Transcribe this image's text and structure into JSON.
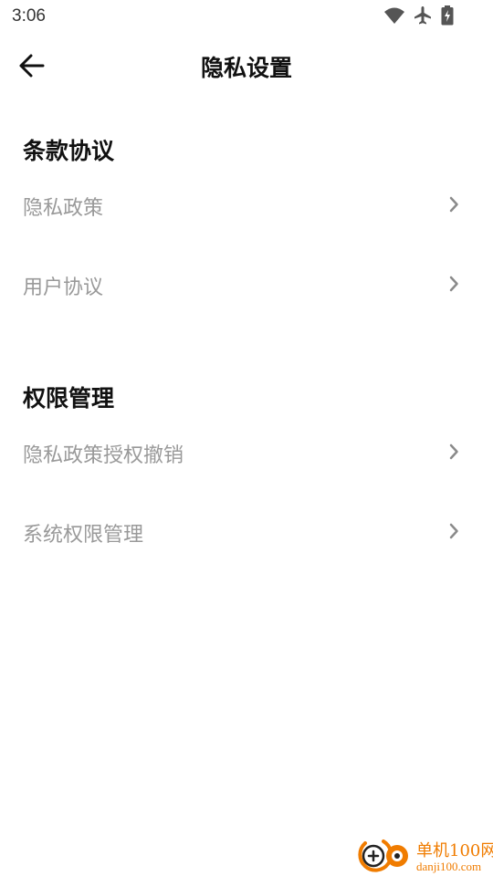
{
  "status_bar": {
    "time": "3:06",
    "icons": [
      "wifi-icon",
      "airplane-mode-icon",
      "battery-charging-icon"
    ]
  },
  "header": {
    "title": "隐私设置",
    "back_icon": "arrow-left-icon"
  },
  "sections": [
    {
      "title": "条款协议",
      "items": [
        {
          "label": "隐私政策"
        },
        {
          "label": "用户协议"
        }
      ]
    },
    {
      "title": "权限管理",
      "items": [
        {
          "label": "隐私政策授权撤销"
        },
        {
          "label": "系统权限管理"
        }
      ]
    }
  ],
  "watermark": {
    "name": "单机100网",
    "domain": "danji100.com"
  },
  "colors": {
    "title": "#111111",
    "item_text": "#999999",
    "chevron": "#8a8a8a",
    "watermark": "#f07c00",
    "background": "#ffffff"
  }
}
